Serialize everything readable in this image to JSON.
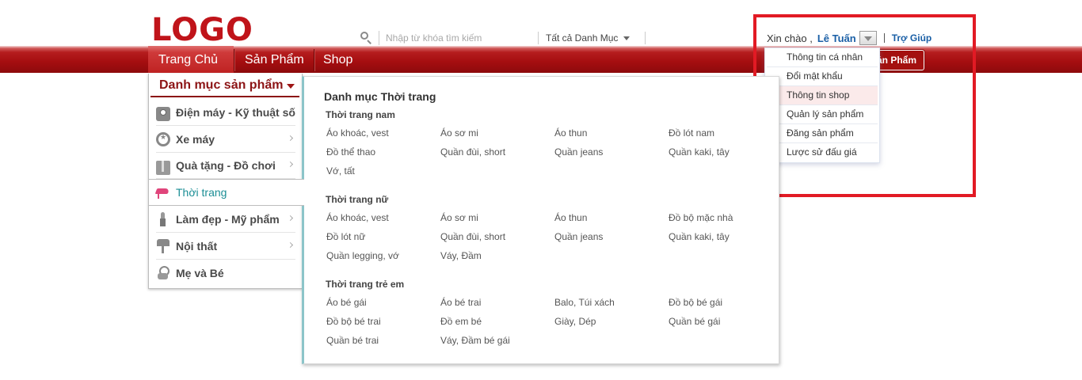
{
  "header": {
    "logo": "LOGO",
    "search_placeholder": "Nhập từ khóa tìm kiếm",
    "category_select": "Tất cả Danh Mục"
  },
  "nav": {
    "items": [
      {
        "label": "Trang Chủ",
        "active": true
      },
      {
        "label": "Sản Phẩm",
        "active": false
      },
      {
        "label": "Shop",
        "active": false
      }
    ],
    "add_product_button": "ản Phẩm"
  },
  "user": {
    "greeting": "Xin chào ,",
    "name": "Lê Tuấn",
    "help": "Trợ Giúp",
    "menu": [
      "Thông tin cá nhân",
      "Đổi mật khẩu",
      "Thông tin shop",
      "Quản lý sản phẩm",
      "Đăng sản phẩm",
      "Lược sử đấu giá"
    ],
    "hovered_index": 2
  },
  "categories": {
    "title": "Danh mục sản phẩm",
    "items": [
      {
        "label": "Điện máy - Kỹ thuật số",
        "icon": "camera-icon"
      },
      {
        "label": "Xe máy",
        "icon": "wheel-icon"
      },
      {
        "label": "Quà tặng - Đồ chơi",
        "icon": "gift-icon"
      },
      {
        "label": "Thời trang",
        "icon": "high-heel-icon",
        "active": true
      },
      {
        "label": "Làm đẹp - Mỹ phẩm",
        "icon": "lipstick-icon"
      },
      {
        "label": "Nội thất",
        "icon": "lamp-icon"
      },
      {
        "label": "Mẹ và Bé",
        "icon": "pacifier-icon"
      }
    ]
  },
  "mega_menu": {
    "title": "Danh mục Thời trang",
    "sections": [
      {
        "title": "Thời trang nam",
        "links": [
          "Áo khoác, vest",
          "Áo sơ mi",
          "Áo thun",
          "Đồ lót nam",
          "Đồ thể thao",
          "Quần đùi, short",
          "Quần jeans",
          "Quần kaki, tây",
          "Vớ, tất"
        ]
      },
      {
        "title": "Thời trang nữ",
        "links": [
          "Áo khoác, vest",
          "Áo sơ mi",
          "Áo thun",
          "Đồ bộ mặc nhà",
          "Đồ lót nữ",
          "Quần đùi, short",
          "Quần jeans",
          "Quần kaki, tây",
          "Quần legging, vớ",
          "Váy, Đầm"
        ]
      },
      {
        "title": "Thời trang trẻ em",
        "links": [
          "Áo bé gái",
          "Áo bé trai",
          "Balo, Túi xách",
          "Đồ bộ bé gái",
          "Đồ bộ bé trai",
          "Đồ em bé",
          "Giày, Dép",
          "Quần bé gái",
          "Quần bé trai",
          "Váy, Đầm bé gái"
        ]
      }
    ]
  },
  "colors": {
    "brand_red": "#c0141a",
    "link_blue": "#1a5fa6",
    "active_teal": "#1b8e95",
    "highlight_red": "#e21a24"
  }
}
